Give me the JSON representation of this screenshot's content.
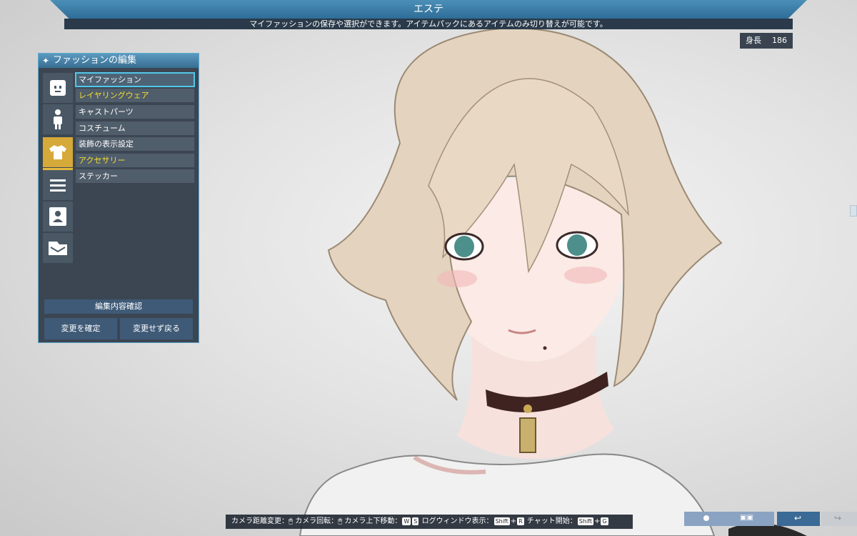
{
  "header": {
    "title": "エステ",
    "subtitle": "マイファッションの保存や選択ができます。アイテムパックにあるアイテムのみ切り替えが可能です。"
  },
  "height": {
    "label": "身長",
    "value": "186"
  },
  "panel": {
    "title": "ファッションの編集",
    "side_icons": [
      {
        "icon": "face-icon"
      },
      {
        "icon": "body-icon"
      },
      {
        "icon": "shirt-icon",
        "active": true
      },
      {
        "icon": "list-icon"
      },
      {
        "icon": "portrait-icon"
      },
      {
        "icon": "folder-icon"
      }
    ],
    "menu_items": [
      {
        "label": "マイファッション",
        "color": "#ffffff",
        "selected": true
      },
      {
        "label": "レイヤリングウェア",
        "color": "#f4e12d"
      },
      {
        "label": "キャストパーツ",
        "color": "#ffffff"
      },
      {
        "label": "コスチューム",
        "color": "#ffffff"
      },
      {
        "label": "装飾の表示設定",
        "color": "#ffffff"
      },
      {
        "label": "アクセサリー",
        "color": "#f4e12d"
      },
      {
        "label": "ステッカー",
        "color": "#ffffff"
      }
    ],
    "confirm_edit": "編集内容確認",
    "apply_changes": "変更を確定",
    "discard_changes": "変更せず戻る"
  },
  "controls": {
    "camera_distance": "カメラ距離変更：",
    "camera_rotate": "カメラ回転：",
    "camera_vertical": "カメラ上下移動：",
    "key_w": "W",
    "key_s": "S",
    "log_window": "ログウィンドウ表示：",
    "key_shift": "Shift",
    "plus": "+",
    "key_r": "R",
    "chat_start": "チャット開始：",
    "key_g": "G"
  },
  "colors": {
    "accent": "#52c7ea",
    "header": "#3a80ab",
    "panel_bg": "#34404c",
    "highlight": "#f4e12d"
  }
}
